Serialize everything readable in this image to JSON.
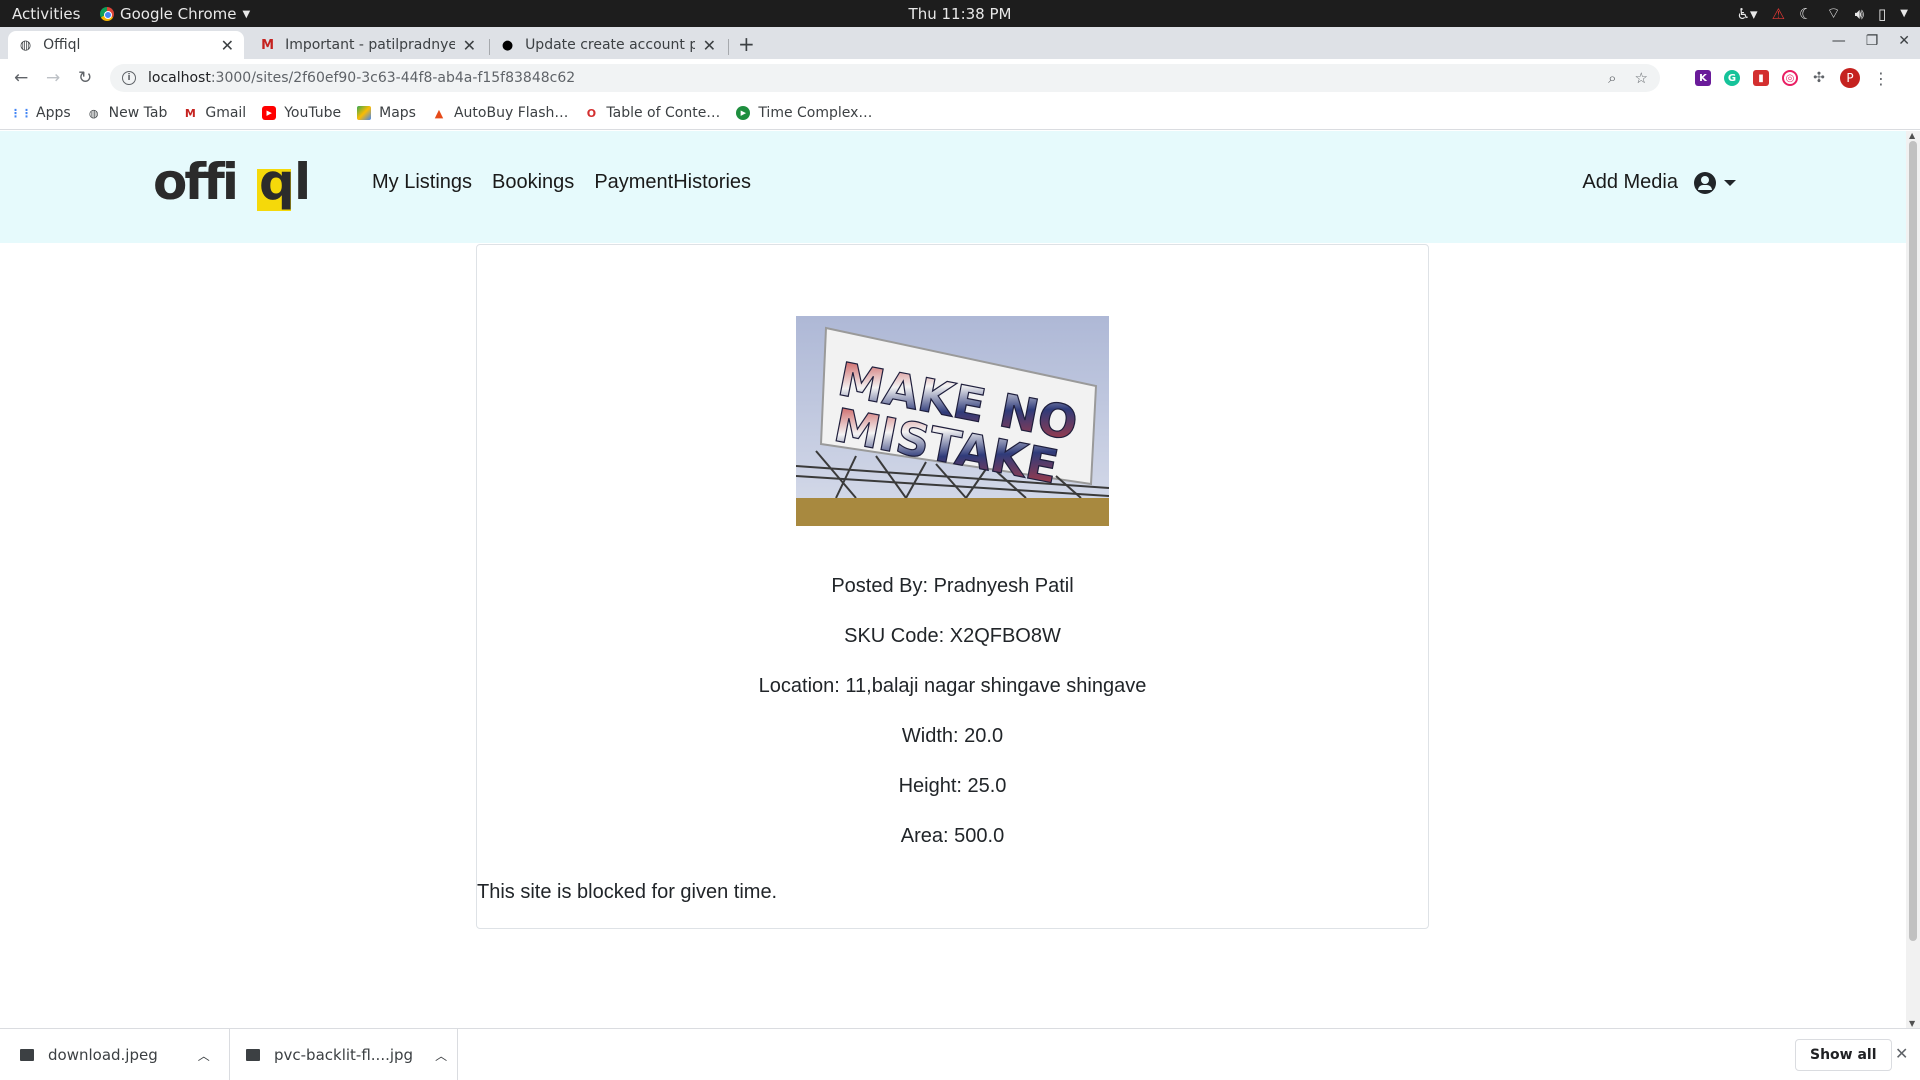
{
  "system_bar": {
    "activities": "Activities",
    "app_name": "Google Chrome",
    "clock": "Thu 11:38 PM"
  },
  "tabs": [
    {
      "title": "Offiql",
      "icon": "globe-icon"
    },
    {
      "title": "Important - patilpradnyesh",
      "icon": "gmail-icon"
    },
    {
      "title": "Update create account pa",
      "icon": "github-icon"
    }
  ],
  "address_bar": {
    "host": "localhost",
    "path": ":3000/sites/2f60ef90-3c63-44f8-ab4a-f15f83848c62"
  },
  "bookmarks": [
    {
      "label": "Apps",
      "icon": "apps-grid-icon"
    },
    {
      "label": "New Tab",
      "icon": "globe-icon"
    },
    {
      "label": "Gmail",
      "icon": "gmail-icon"
    },
    {
      "label": "YouTube",
      "icon": "youtube-icon"
    },
    {
      "label": "Maps",
      "icon": "maps-icon"
    },
    {
      "label": "AutoBuy Flash…",
      "icon": "autobuy-icon"
    },
    {
      "label": "Table of Conte…",
      "icon": "opera-icon"
    },
    {
      "label": "Time Complex…",
      "icon": "play-icon"
    }
  ],
  "app": {
    "logo_text": "offiql",
    "nav_links": [
      "My Listings",
      "Bookings",
      "PaymentHistories"
    ],
    "add_media": "Add Media"
  },
  "listing": {
    "image_text_line1": "MAKE NO",
    "image_text_line2": "MISTAKE",
    "posted_by": "Posted By: Pradnyesh Patil",
    "sku": "SKU Code: X2QFBO8W",
    "location": "Location: 11,balaji nagar shingave shingave",
    "width": "Width: 20.0",
    "height": "Height: 25.0",
    "area": "Area: 500.0",
    "blocked_msg": "This site is blocked for given time."
  },
  "downloads": [
    {
      "name": "download.jpeg"
    },
    {
      "name": "pvc-backlit-fl....jpg"
    }
  ],
  "downloads_show_all": "Show all",
  "colors": {
    "navbar_bg": "#e6fafc",
    "logo_accent": "#f5d90a"
  }
}
